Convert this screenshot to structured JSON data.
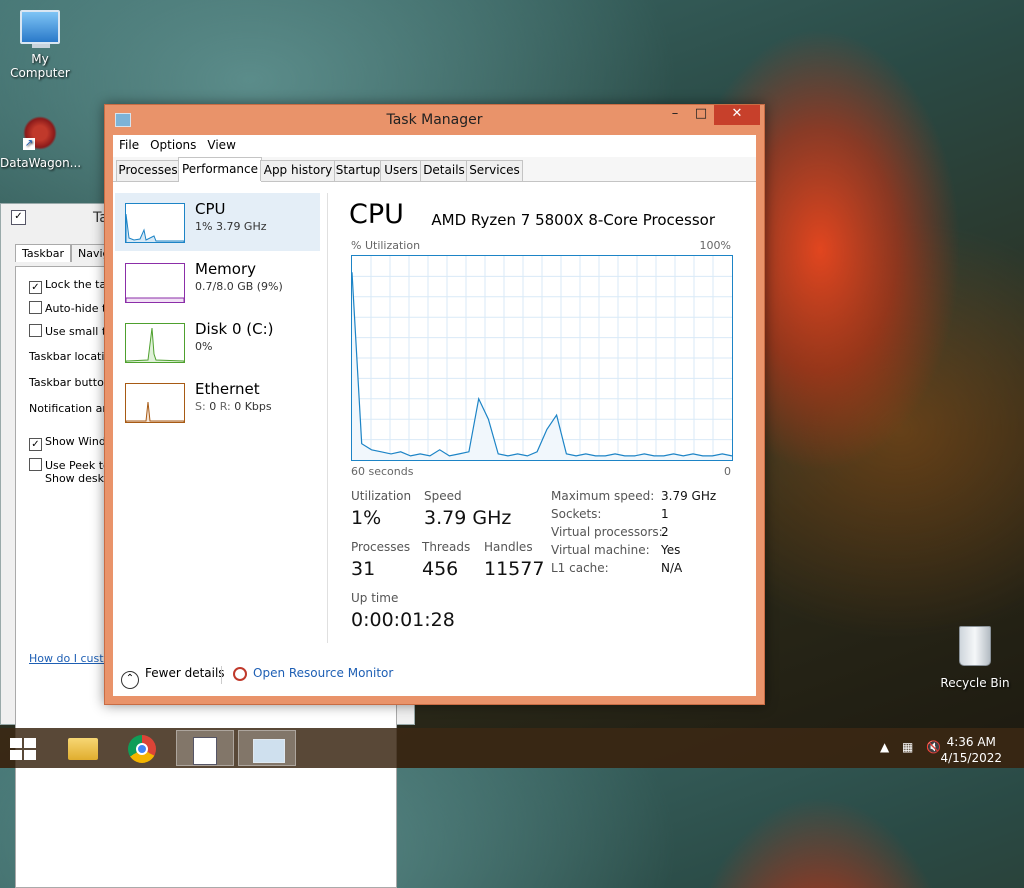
{
  "desktop": {
    "icons": [
      {
        "label": "My Computer"
      },
      {
        "label": "DataWagon..."
      },
      {
        "label": "Recycle Bin"
      }
    ]
  },
  "bg_window": {
    "title": "Ta",
    "tabs": [
      "Taskbar",
      "Naviga"
    ],
    "options": [
      {
        "label": "Lock the task",
        "checked": true
      },
      {
        "label": "Auto-hide th",
        "checked": false
      },
      {
        "label": "Use small tas",
        "checked": false
      }
    ],
    "labels": [
      "Taskbar location",
      "Taskbar buttons",
      "Notification area"
    ],
    "show_windows": {
      "label": "Show Windo",
      "checked": true
    },
    "peek": {
      "line1": "Use Peek to",
      "line2": "Show deskto",
      "checked": false
    },
    "link": "How do I custom"
  },
  "task_manager": {
    "title": "Task Manager",
    "window_buttons": {
      "minimize": "–",
      "maximize": "□",
      "close": "✕"
    },
    "menu": [
      "File",
      "Options",
      "View"
    ],
    "tabs": [
      "Processes",
      "Performance",
      "App history",
      "Startup",
      "Users",
      "Details",
      "Services"
    ],
    "active_tab": "Performance",
    "resources": [
      {
        "name": "CPU",
        "sub": "1% 3.79 GHz",
        "color": "#1d84c6",
        "selected": true
      },
      {
        "name": "Memory",
        "sub": "0.7/8.0 GB (9%)",
        "color": "#8b2ea8",
        "selected": false
      },
      {
        "name": "Disk 0 (C:)",
        "sub": "0%",
        "color": "#4ea02e",
        "selected": false
      },
      {
        "name": "Ethernet",
        "sub": "S: 0 R: 0 Kbps",
        "color": "#a75a14",
        "selected": false
      }
    ],
    "ethernet_sub": {
      "s_label": "S:",
      "s_value": "0",
      "r_label": "R:",
      "r_value": "0 Kbps"
    },
    "cpu": {
      "heading": "CPU",
      "processor": "AMD Ryzen 7 5800X 8-Core Processor",
      "util_label": "% Utilization",
      "max_label": "100%",
      "time_label": "60 seconds",
      "zero_label": "0",
      "stats": {
        "utilization": {
          "label": "Utilization",
          "value": "1%"
        },
        "speed": {
          "label": "Speed",
          "value": "3.79 GHz"
        },
        "processes": {
          "label": "Processes",
          "value": "31"
        },
        "threads": {
          "label": "Threads",
          "value": "456"
        },
        "handles": {
          "label": "Handles",
          "value": "11577"
        },
        "uptime": {
          "label": "Up time",
          "value": "0:00:01:28"
        }
      },
      "details": [
        {
          "label": "Maximum speed:",
          "value": "3.79 GHz"
        },
        {
          "label": "Sockets:",
          "value": "1"
        },
        {
          "label": "Virtual processors:",
          "value": "2"
        },
        {
          "label": "Virtual machine:",
          "value": "Yes"
        },
        {
          "label": "L1 cache:",
          "value": "N/A"
        }
      ],
      "history_percent": [
        92,
        8,
        5,
        4,
        3,
        4,
        2,
        3,
        2,
        5,
        2,
        3,
        4,
        30,
        20,
        3,
        2,
        3,
        2,
        4,
        15,
        22,
        3,
        2,
        3,
        2,
        2,
        3,
        2,
        2,
        3,
        2,
        2,
        3,
        2,
        3,
        2,
        2,
        3,
        2
      ]
    },
    "footer": {
      "fewer": "Fewer details",
      "open_rm": "Open Resource Monitor"
    }
  },
  "taskbar": {
    "time": "4:36 AM",
    "date": "4/15/2022"
  }
}
